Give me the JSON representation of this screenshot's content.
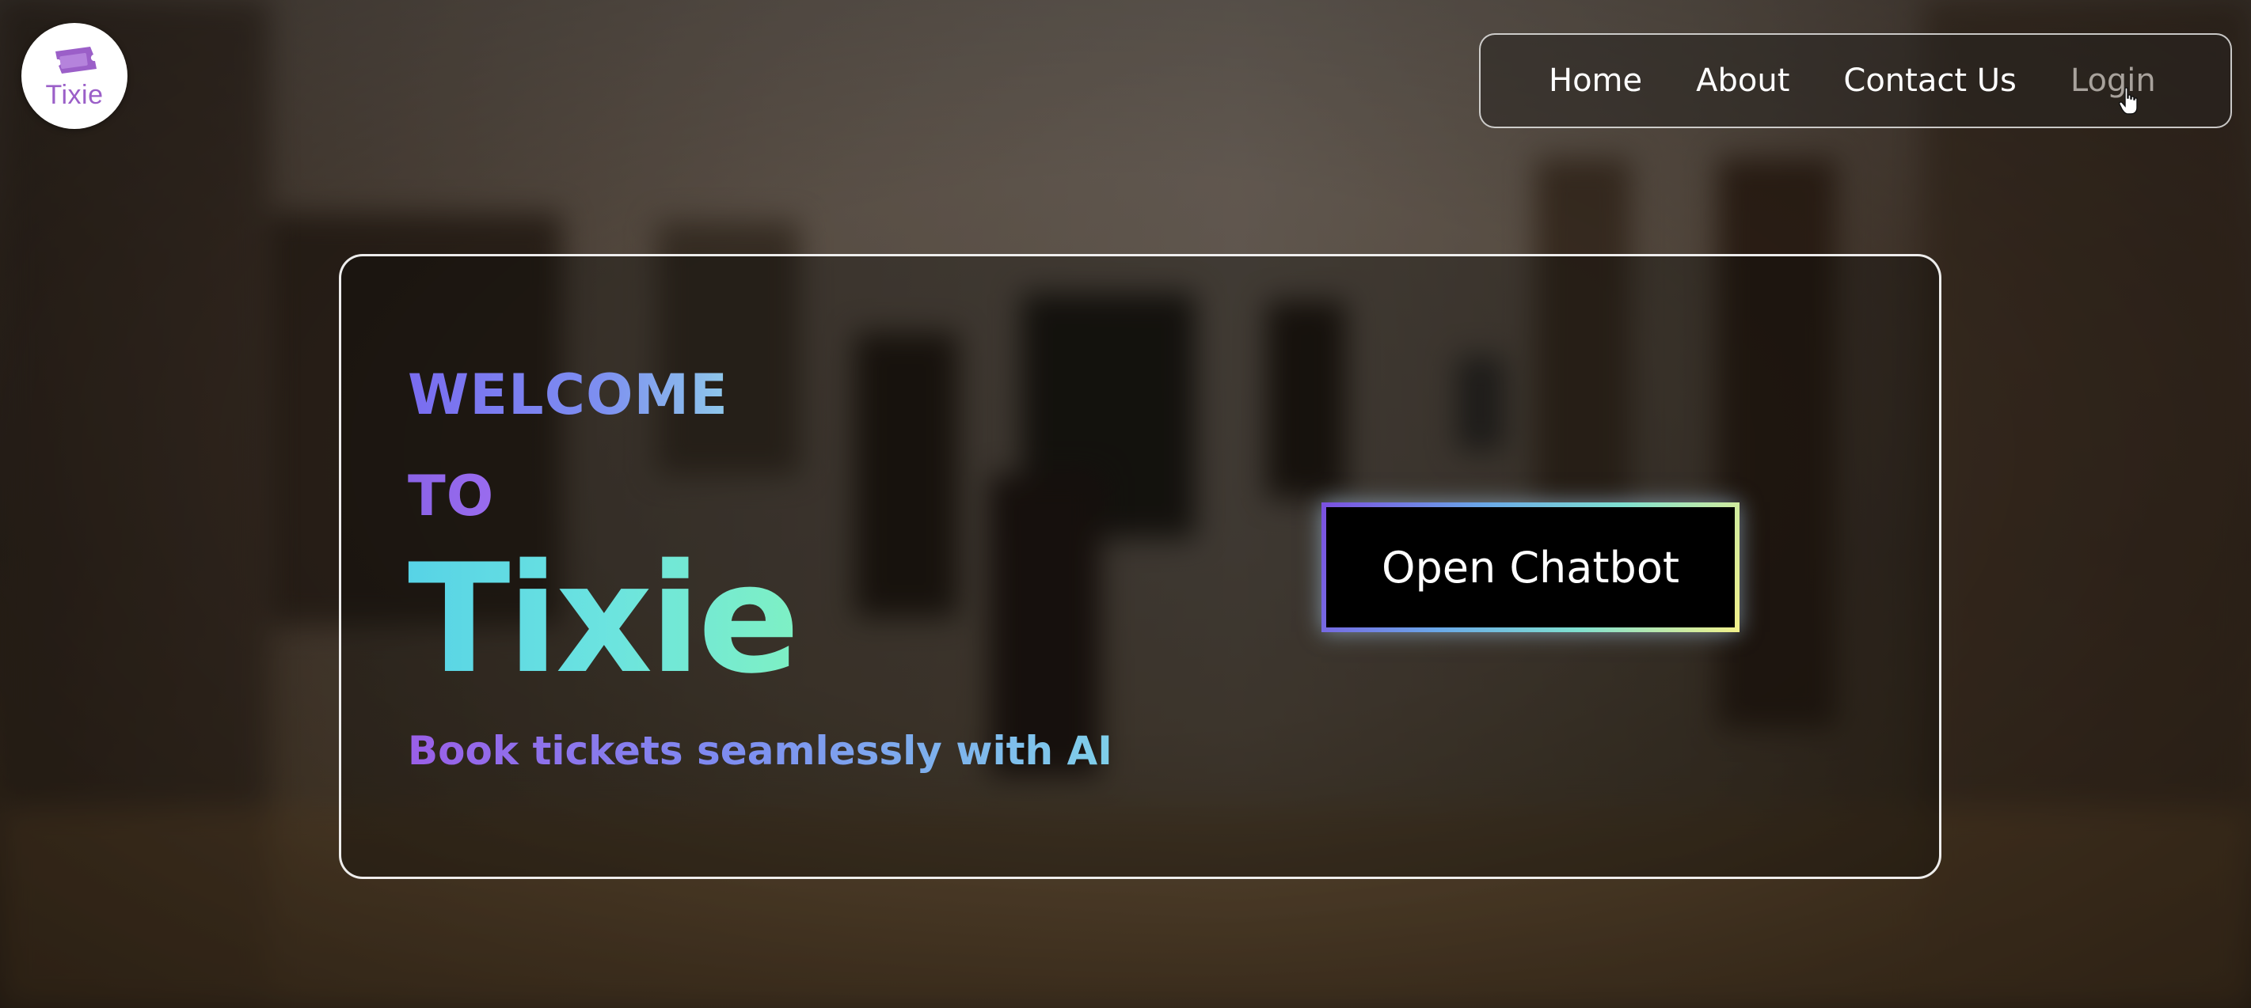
{
  "brand": {
    "logo_text": "Tixie",
    "logo_icon": "ticket-icon",
    "logo_color": "#9b5fc8"
  },
  "nav": {
    "items": [
      {
        "label": "Home"
      },
      {
        "label": "About"
      },
      {
        "label": "Contact Us"
      },
      {
        "label": "Login",
        "state": "hovered"
      }
    ]
  },
  "hero": {
    "welcome": "WELCOME",
    "to": "TO",
    "title": "Tixie",
    "tagline": "Book tickets seamlessly with AI",
    "cta_label": "Open Chatbot"
  },
  "colors": {
    "gradient_purple": "#7a6cf0",
    "gradient_teal": "#6be3e0",
    "cta_border_start": "#7b4fe0",
    "cta_border_end": "#f2f08a",
    "cta_background": "#000000"
  }
}
